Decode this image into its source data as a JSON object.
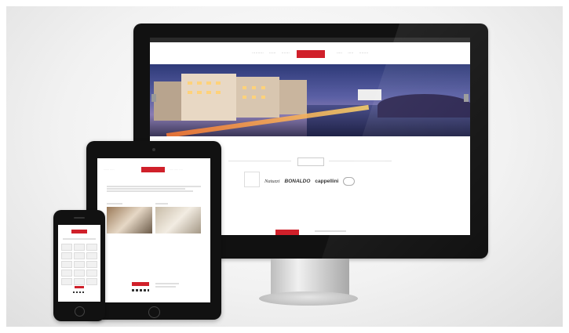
{
  "scene": {
    "description_free": true
  },
  "desktop": {
    "topbar_text": "",
    "nav_left": [
      "",
      "",
      ""
    ],
    "nav_right": [
      "",
      "",
      ""
    ],
    "logo_text": "",
    "section_title": "",
    "brands": [
      "Natuzzi",
      "Natuzzi",
      "BONALDO",
      "cappellini",
      ""
    ]
  },
  "colors": {
    "accent": "#d0202a",
    "device_frame": "#111111",
    "background": "#f2f2f2"
  }
}
